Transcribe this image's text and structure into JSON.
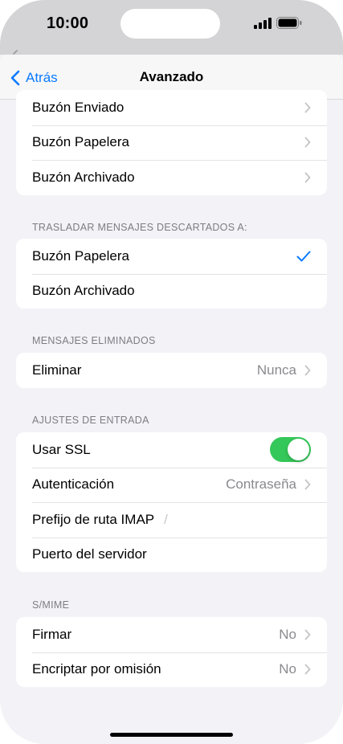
{
  "status": {
    "time": "10:00"
  },
  "nav": {
    "back_label": "Atrás",
    "title": "Avanzado"
  },
  "mailbox_group": {
    "items": [
      {
        "label": "Buzón Enviado"
      },
      {
        "label": "Buzón Papelera"
      },
      {
        "label": "Buzón Archivado"
      }
    ]
  },
  "discard": {
    "header": "TRASLADAR MENSAJES DESCARTADOS A:",
    "items": [
      {
        "label": "Buzón Papelera",
        "selected": true
      },
      {
        "label": "Buzón Archivado",
        "selected": false
      }
    ]
  },
  "deleted": {
    "header": "MENSAJES ELIMINADOS",
    "remove_label": "Eliminar",
    "remove_value": "Nunca"
  },
  "incoming": {
    "header": "AJUSTES DE ENTRADA",
    "ssl_label": "Usar SSL",
    "ssl_on": true,
    "auth_label": "Autenticación",
    "auth_value": "Contraseña",
    "imap_label": "Prefijo de ruta IMAP",
    "imap_placeholder": "/",
    "port_label": "Puerto del servidor"
  },
  "smime": {
    "header": "S/MIME",
    "sign_label": "Firmar",
    "sign_value": "No",
    "encrypt_label": "Encriptar por omisión",
    "encrypt_value": "No"
  },
  "colors": {
    "accent": "#0a7aff",
    "toggle_on": "#34c759",
    "secondary_text": "#8a8a8e",
    "background": "#f2f2f7"
  }
}
